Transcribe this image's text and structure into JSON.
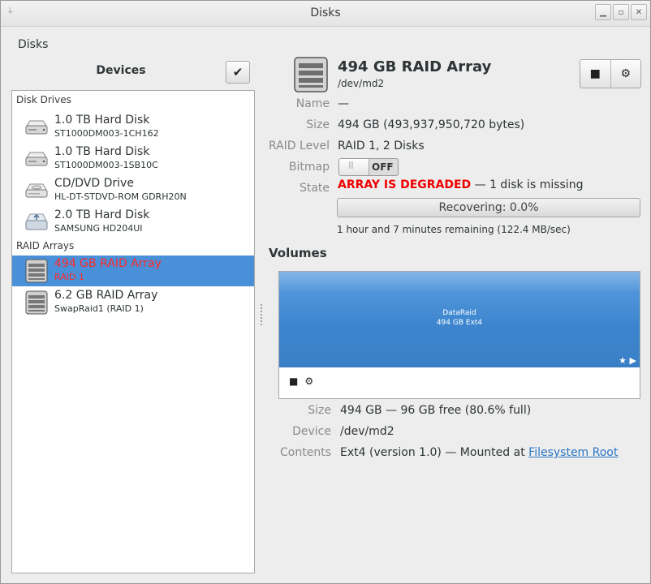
{
  "window": {
    "title": "Disks"
  },
  "menubar": {
    "label": "Disks"
  },
  "sidebar": {
    "heading": "Devices",
    "groups": [
      "Disk Drives",
      "RAID Arrays"
    ],
    "items": [
      {
        "title": "1.0 TB Hard Disk",
        "subtitle": "ST1000DM003-1CH162",
        "icon": "hard-disk-icon"
      },
      {
        "title": "1.0 TB Hard Disk",
        "subtitle": "ST1000DM003-1SB10C",
        "icon": "hard-disk-icon"
      },
      {
        "title": "CD/DVD Drive",
        "subtitle": "HL-DT-STDVD-ROM GDRH20N",
        "icon": "optical-drive-icon"
      },
      {
        "title": "2.0 TB Hard Disk",
        "subtitle": "SAMSUNG HD204UI",
        "icon": "usb-disk-icon"
      },
      {
        "title": "494 GB RAID Array",
        "subtitle": "RAID 1",
        "icon": "raid-array-icon",
        "selected": true
      },
      {
        "title": "6.2 GB RAID Array",
        "subtitle": "SwapRaid1 (RAID 1)",
        "icon": "raid-array-icon"
      }
    ]
  },
  "device": {
    "title": "494 GB RAID Array",
    "path": "/dev/md2",
    "labels": {
      "name": "Name",
      "size": "Size",
      "raid_level": "RAID Level",
      "bitmap": "Bitmap",
      "state": "State"
    },
    "name": "—",
    "size": "494 GB (493,937,950,720 bytes)",
    "raid_level": "RAID 1, 2 Disks",
    "bitmap": "OFF",
    "state_status": "ARRAY IS DEGRADED",
    "state_detail": " — 1 disk is missing",
    "progress_text": "Recovering: 0.0%",
    "progress_fraction": 0.0,
    "remaining": "1 hour and 7 minutes remaining (122.4 MB/sec)"
  },
  "volumes": {
    "heading": "Volumes",
    "partition_name": "DataRaid",
    "partition_info": "494 GB Ext4",
    "labels": {
      "size": "Size",
      "device": "Device",
      "contents": "Contents"
    },
    "size": "494 GB — 96 GB free (80.6% full)",
    "device": "/dev/md2",
    "contents_text": "Ext4 (version 1.0) — Mounted at ",
    "contents_link": "Filesystem Root"
  },
  "colors": {
    "selection": "#4a90d9",
    "degraded": "#ee0000",
    "partition": "#3d86cf",
    "link": "#2a76c6"
  }
}
